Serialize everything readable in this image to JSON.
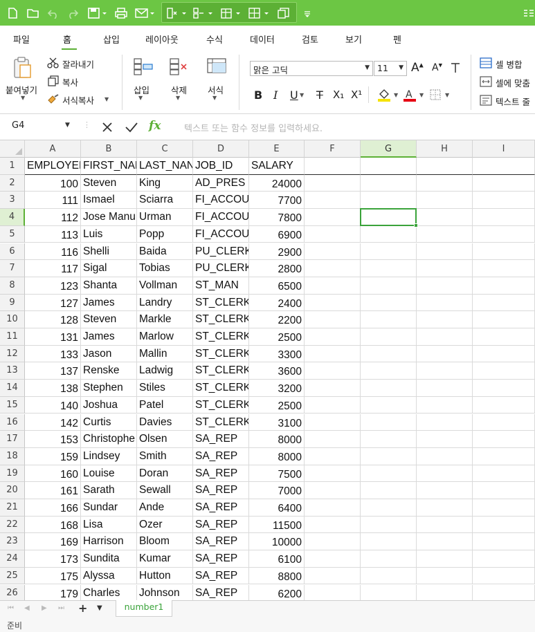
{
  "accent_color": "#6cc644",
  "quick_access": {
    "icons": [
      "new-doc-icon",
      "open-folder-icon",
      "undo-icon",
      "redo-icon",
      "save-icon",
      "print-icon",
      "email-icon",
      "insert-cells-icon",
      "delete-cells-icon",
      "format-cells-icon",
      "borders-icon",
      "copy-format-icon",
      "customize-icon",
      "more-icon"
    ]
  },
  "menu": {
    "tabs": [
      "파일",
      "홈",
      "삽입",
      "레이아웃",
      "수식",
      "데이터",
      "검토",
      "보기",
      "펜"
    ],
    "active": "홈"
  },
  "ribbon": {
    "paste_label": "붙여넣기",
    "cut_label": "잘라내기",
    "copy_label": "복사",
    "format_painter_label": "서식복사",
    "insert_label": "삽입",
    "delete_label": "삭제",
    "format_label": "서식",
    "font_name": "맑은 고딕",
    "font_size": "11",
    "bold": "B",
    "italic": "I",
    "underline": "U",
    "strike": "T",
    "subscript": "X₁",
    "superscript": "X¹",
    "merge_label": "셀 병합",
    "fit_label": "셀에 맞춤",
    "text_wrap_label": "텍스트 줄"
  },
  "formula_bar": {
    "cell_ref": "G4",
    "fx": "fx",
    "placeholder": "텍스트 또는 함수 정보를 입력하세요."
  },
  "grid": {
    "columns": [
      "A",
      "B",
      "C",
      "D",
      "E",
      "F",
      "G",
      "H",
      "I"
    ],
    "selected_column": "G",
    "selected_row": "4",
    "header_row": [
      "EMPLOYEE",
      "FIRST_NAN",
      "LAST_NAN",
      "JOB_ID",
      "SALARY"
    ],
    "rows": [
      [
        "100",
        "Steven",
        "King",
        "AD_PRES",
        "24000"
      ],
      [
        "111",
        "Ismael",
        "Sciarra",
        "FI_ACCOU",
        "7700"
      ],
      [
        "112",
        "Jose Manu",
        "Urman",
        "FI_ACCOU",
        "7800"
      ],
      [
        "113",
        "Luis",
        "Popp",
        "FI_ACCOU",
        "6900"
      ],
      [
        "116",
        "Shelli",
        "Baida",
        "PU_CLERK",
        "2900"
      ],
      [
        "117",
        "Sigal",
        "Tobias",
        "PU_CLERK",
        "2800"
      ],
      [
        "123",
        "Shanta",
        "Vollman",
        "ST_MAN",
        "6500"
      ],
      [
        "127",
        "James",
        "Landry",
        "ST_CLERK",
        "2400"
      ],
      [
        "128",
        "Steven",
        "Markle",
        "ST_CLERK",
        "2200"
      ],
      [
        "131",
        "James",
        "Marlow",
        "ST_CLERK",
        "2500"
      ],
      [
        "133",
        "Jason",
        "Mallin",
        "ST_CLERK",
        "3300"
      ],
      [
        "137",
        "Renske",
        "Ladwig",
        "ST_CLERK",
        "3600"
      ],
      [
        "138",
        "Stephen",
        "Stiles",
        "ST_CLERK",
        "3200"
      ],
      [
        "140",
        "Joshua",
        "Patel",
        "ST_CLERK",
        "2500"
      ],
      [
        "142",
        "Curtis",
        "Davies",
        "ST_CLERK",
        "3100"
      ],
      [
        "153",
        "Christophe",
        "Olsen",
        "SA_REP",
        "8000"
      ],
      [
        "159",
        "Lindsey",
        "Smith",
        "SA_REP",
        "8000"
      ],
      [
        "160",
        "Louise",
        "Doran",
        "SA_REP",
        "7500"
      ],
      [
        "161",
        "Sarath",
        "Sewall",
        "SA_REP",
        "7000"
      ],
      [
        "166",
        "Sundar",
        "Ande",
        "SA_REP",
        "6400"
      ],
      [
        "168",
        "Lisa",
        "Ozer",
        "SA_REP",
        "11500"
      ],
      [
        "169",
        "Harrison",
        "Bloom",
        "SA_REP",
        "10000"
      ],
      [
        "173",
        "Sundita",
        "Kumar",
        "SA_REP",
        "6100"
      ],
      [
        "175",
        "Alyssa",
        "Hutton",
        "SA_REP",
        "8800"
      ],
      [
        "179",
        "Charles",
        "Johnson",
        "SA_REP",
        "6200"
      ]
    ]
  },
  "sheet_tabs": {
    "add": "+",
    "menu": "▼",
    "sheets": [
      "number1"
    ]
  },
  "status": {
    "ready": "준비"
  }
}
